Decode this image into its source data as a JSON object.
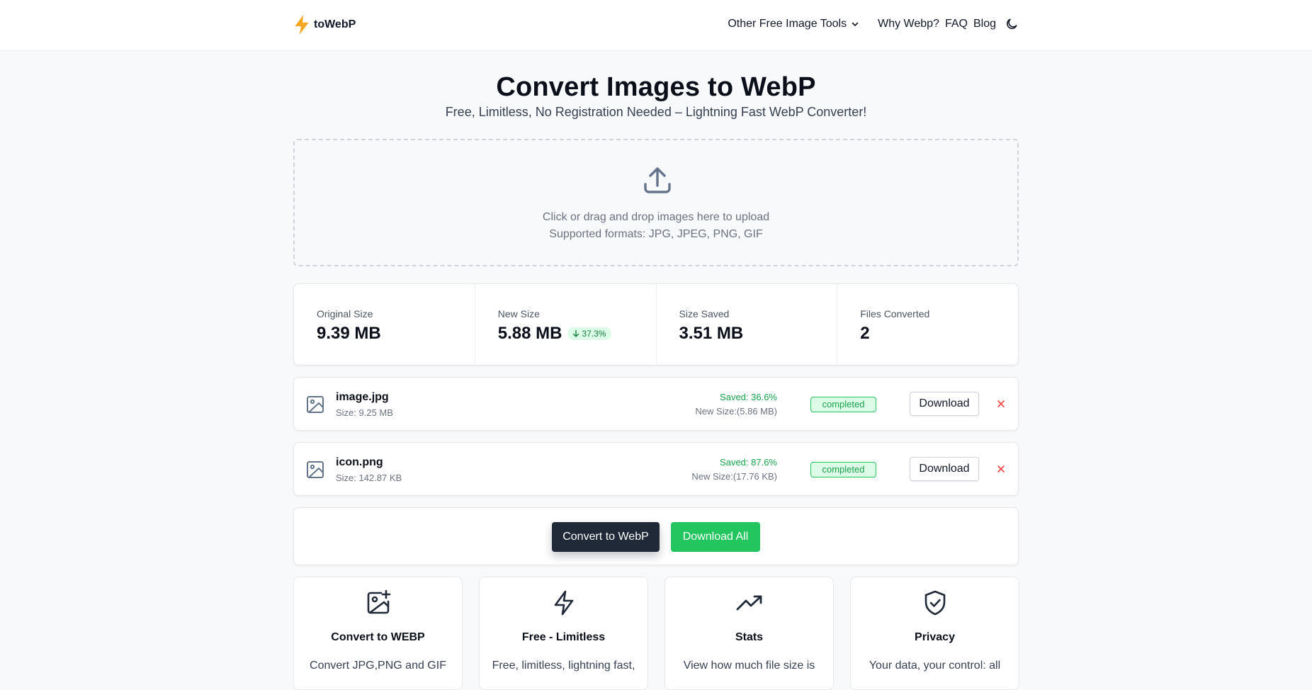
{
  "header": {
    "brand": "toWebP",
    "nav": {
      "tools": "Other Free Image Tools",
      "why": "Why Webp?",
      "faq": "FAQ",
      "blog": "Blog"
    }
  },
  "hero": {
    "title": "Convert Images to WebP",
    "subtitle": "Free, Limitless, No Registration Needed – Lightning Fast WebP Converter!"
  },
  "upload": {
    "line1": "Click or drag and drop images here to upload",
    "line2": "Supported formats: JPG, JPEG, PNG, GIF"
  },
  "stats": [
    {
      "label": "Original Size",
      "value": "9.39 MB"
    },
    {
      "label": "New Size",
      "value": "5.88 MB",
      "badge": "37.3%"
    },
    {
      "label": "Size Saved",
      "value": "3.51 MB"
    },
    {
      "label": "Files Converted",
      "value": "2"
    }
  ],
  "files": [
    {
      "name": "image.jpg",
      "size": "Size: 9.25 MB",
      "saved": "Saved: 36.6%",
      "new_size": "New Size:(5.86 MB)",
      "status": "completed",
      "download": "Download"
    },
    {
      "name": "icon.png",
      "size": "Size: 142.87 KB",
      "saved": "Saved: 87.6%",
      "new_size": "New Size:(17.76 KB)",
      "status": "completed",
      "download": "Download"
    }
  ],
  "actions": {
    "convert": "Convert to WebP",
    "download_all": "Download All"
  },
  "features": [
    {
      "icon": "image-plus-icon",
      "title": "Convert to WEBP",
      "desc": "Convert JPG,PNG and GIF"
    },
    {
      "icon": "zap-icon",
      "title": "Free - Limitless",
      "desc": "Free, limitless, lightning fast,"
    },
    {
      "icon": "trending-up-icon",
      "title": "Stats",
      "desc": "View how much file size is"
    },
    {
      "icon": "shield-check-icon",
      "title": "Privacy",
      "desc": "Your data, your control: all"
    }
  ],
  "colors": {
    "accent": "#f59e0b",
    "success": "#22c55e",
    "danger": "#ef4444",
    "primary_dark": "#1f2937"
  }
}
